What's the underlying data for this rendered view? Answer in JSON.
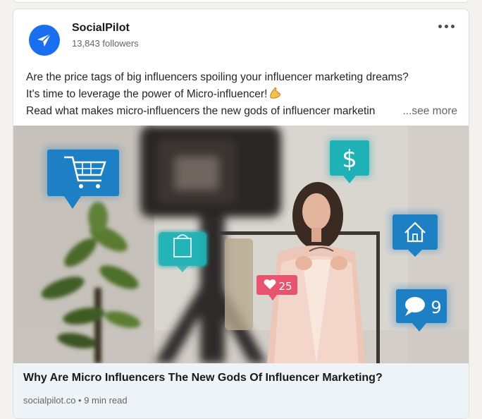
{
  "post": {
    "author": "SocialPilot",
    "followers": "13,843 followers",
    "text_lines": [
      "Are the price tags of big influencers spoiling your influencer marketing dreams?",
      "It's time to leverage the power of Micro-influencer!",
      "Read what makes micro-influencers the new gods of influencer marketin"
    ],
    "see_more": "...see more"
  },
  "article": {
    "title": "Why Are Micro Influencers The New Gods Of Influencer Marketing?",
    "meta": "socialpilot.co • 9 min read",
    "image_overlays": {
      "dollar": "$",
      "likes": "25",
      "comments": "9"
    }
  },
  "icons": {
    "logo": "paper-plane-icon",
    "more": "more-horizontal-icon",
    "emoji": "flexed-biceps-icon"
  },
  "colors": {
    "brand_blue": "#1a6ff0",
    "icon_blue": "#1d7fc4",
    "icon_teal": "#1eb1b5",
    "heart_pink": "#e8536f",
    "footer_bg": "#eef3f8"
  }
}
